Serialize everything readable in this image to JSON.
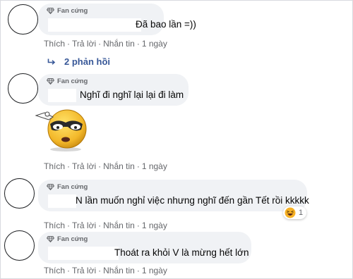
{
  "comments": [
    {
      "badge": "Fan cứng",
      "text": "Đã bao lần =))",
      "actions": [
        "Thích",
        "Trả lời",
        "Nhắn tin",
        "1 ngày"
      ]
    },
    {
      "badge": "Fan cứng",
      "text": "Nghĩ đi nghĩ lại lại đi làm",
      "actions": [
        "Thích",
        "Trả lời",
        "Nhắn tin",
        "1 ngày"
      ]
    },
    {
      "badge": "Fan cứng",
      "text": "N lần muốn nghỉ việc nhưng nghĩ đến gần Tết rồi kkkkk",
      "actions": [
        "Thích",
        "Trả lời",
        "Nhắn tin",
        "1 ngày"
      ],
      "reaction_count": "1"
    },
    {
      "badge": "Fan cứng",
      "text": "Thoát ra khỏi V là mừng hết lớn",
      "actions": [
        "Thích",
        "Trả lời",
        "Nhắn tin",
        "1 ngày"
      ]
    }
  ],
  "replies_link": "2 phản hồi",
  "colors": {
    "bubble": "#f0f2f5",
    "link": "#385898",
    "meta": "#65676b",
    "reaction": "#f7b125"
  },
  "icons": {
    "badge": "diamond-icon",
    "reply": "reply-arrow-icon",
    "reaction": "laughing-emoji-icon",
    "sticker": "sunglasses-emoji-sticker"
  }
}
